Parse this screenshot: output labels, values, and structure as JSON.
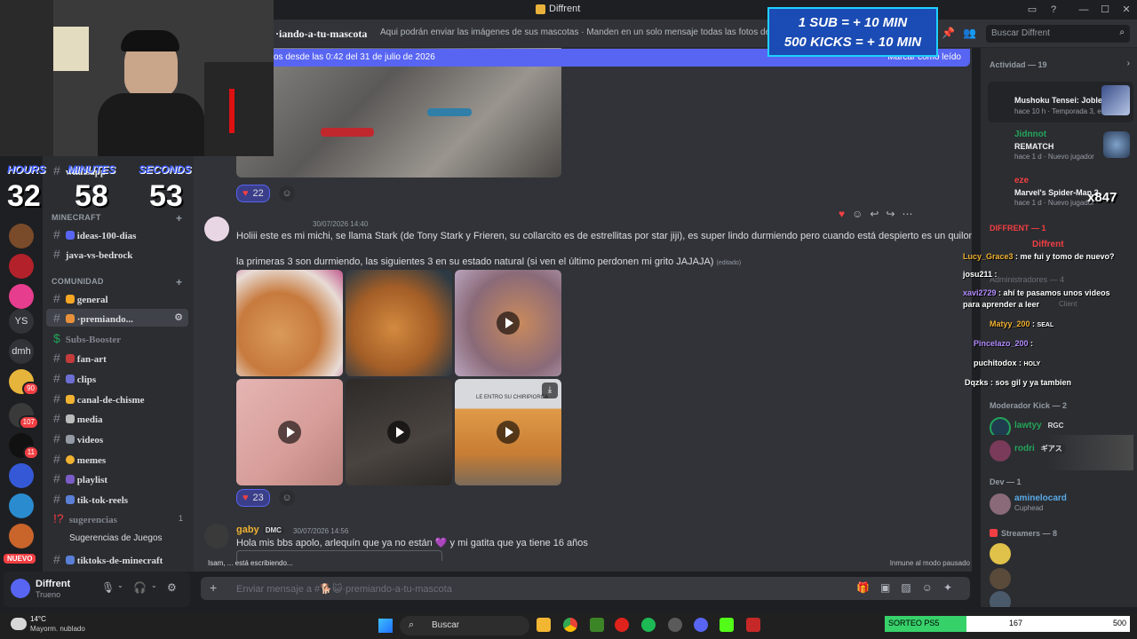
{
  "window": {
    "title": "Diffrent"
  },
  "header": {
    "channel_name": "·iando-a-tu-mascota",
    "topic": "Aqui podrán enviar las imágenes de sus mascotas · Manden en un solo mensaje todas las fotos de s",
    "search_placeholder": "Buscar Diffrent"
  },
  "new_messages_bar": {
    "text": "os desde las 0:42 del 31 de julio de 2026",
    "mark_read": "Marcar como leído"
  },
  "server_rail": {
    "home_initials": "YS",
    "dmh": "dmh",
    "badges": [
      "90",
      "107",
      "11"
    ],
    "new_label": "NUEVO"
  },
  "categories": {
    "minecraft": "MINECRAFT",
    "comunidad": "COMUNIDAD"
  },
  "channels": {
    "top": "whatsapp",
    "minecraft": [
      {
        "name": "ideas-100-dias"
      },
      {
        "name": "java-vs-bedrock"
      }
    ],
    "comunidad": [
      {
        "name": "general"
      },
      {
        "name": "·premiando..."
      },
      {
        "name": "Subs-Booster"
      },
      {
        "name": "fan-art"
      },
      {
        "name": "clips"
      },
      {
        "name": "canal-de-chisme"
      },
      {
        "name": "media"
      },
      {
        "name": "videos"
      },
      {
        "name": "memes"
      },
      {
        "name": "playlist"
      },
      {
        "name": "tik-tok-reels"
      },
      {
        "name": "sugerencias",
        "count": "1"
      },
      {
        "name": "Sugerencias de Juegos"
      },
      {
        "name": "tiktoks-de-minecraft"
      }
    ]
  },
  "user_panel": {
    "name": "Diffrent",
    "status": "Trueno"
  },
  "messages": [
    {
      "reaction_count": "22"
    },
    {
      "author": "",
      "time": "30/07/2026 14:40",
      "text1": "Holiii este es mi michi, se llama Stark (de Tony Stark y Frieren, su collarcito es de estrellitas por star jiji), es super lindo durmiendo pero cuando está despierto es un quilombero",
      "text2": "la primeras 3 son durmiendo, las siguientes 3 en su estado natural",
      "text2b": "(si ven el último perdonen mi grito JAJAJA)",
      "edited": "(editado)",
      "reaction_count": "23",
      "video_caption": "LE ENTRO SU CHIRIPIORCA"
    },
    {
      "author": "gaby",
      "tag": "DMC",
      "time": "30/07/2026 14:56",
      "text": "Hola mis bbs apolo, arlequín que ya no están 💜 y mi gatita que ya tiene 16 años"
    }
  ],
  "typing": "Isam, ... está escribiendo...",
  "immune": "Inmune al modo pausado",
  "composer": {
    "placeholder": "Enviar mensaje a #🐕😺·premiando-a-tu-mascota"
  },
  "members": {
    "activity_header": "Actividad — 19",
    "activity": [
      {
        "name": "",
        "game": "Mushoku Tensei: Jobless R...",
        "meta": "hace 10 h",
        "meta2": "Temporada 3, e..."
      },
      {
        "name": "Jidnnot",
        "game": "REMATCH",
        "meta": "hace 1 d",
        "meta2": "Nuevo jugador"
      },
      {
        "name": "eze",
        "game": "Marvel's Spider-Man 2",
        "meta": "hace 1 d",
        "meta2": "Nuevo jugador"
      }
    ],
    "diffrent_header": "DIFFRENT — 1",
    "diffrent_member": "Diffrent",
    "admins_header": "Administradores — 4",
    "client_text": "Client",
    "mods_header": "Moderador Kick — 2",
    "mods": [
      {
        "name": "lawtyy",
        "tag": "RGC"
      },
      {
        "name": "rodri",
        "tag": "ギアス"
      }
    ],
    "dev_header": "Dev — 1",
    "dev": {
      "name": "aminelocard",
      "status": "Cuphead"
    },
    "streamers_header": "Streamers — 8"
  },
  "overlay": {
    "timer_labels": [
      "HOURS",
      "MINUTES",
      "SECONDS"
    ],
    "timer_values": [
      "32",
      "58",
      "53"
    ],
    "sub_line1": "1 SUB = + 10 MIN",
    "sub_line2": "500 KICKS = + 10 MIN",
    "kick_count": "x847",
    "stream_chat": [
      {
        "user": "Lucy_Grace3",
        "msg": "me fui y tomo de nuevo?"
      },
      {
        "user": "josu211",
        "msg": ""
      },
      {
        "user": "xavi2729",
        "msg": "ahí te pasamos unos videos"
      },
      {
        "user": "",
        "msg": "para aprender a leer"
      },
      {
        "user": "Matyy_200",
        "msg": "SEAL"
      },
      {
        "user": "Pincelazo_200",
        "msg": ""
      },
      {
        "user": "puchitodox",
        "msg": "HOLY"
      },
      {
        "user": "Dqzks",
        "msg": "sos gil y ya tambien"
      }
    ]
  },
  "taskbar": {
    "weather_temp": "14°C",
    "weather_cond": "Mayorm. nublado",
    "search": "Buscar",
    "goal_label": "SORTEO PS5",
    "goal_current": "167",
    "goal_max": "500",
    "goal_progress": 0.334
  },
  "colors": {
    "blurple": "#5865f2",
    "bg": "#313338",
    "sidebar": "#2b2d31",
    "green": "#23a55a",
    "red": "#f23f43"
  }
}
